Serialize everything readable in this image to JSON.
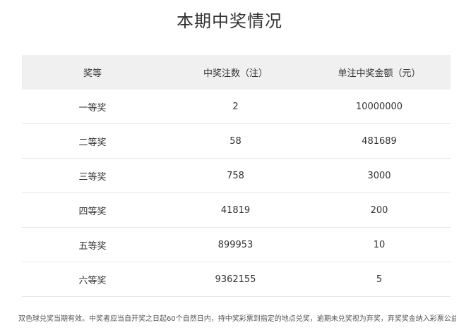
{
  "title": "本期中奖情况",
  "table": {
    "headers": [
      "奖等",
      "中奖注数（注）",
      "单注中奖金额（元）"
    ],
    "rows": [
      {
        "level": "一等奖",
        "count": "2",
        "amount": "10000000"
      },
      {
        "level": "二等奖",
        "count": "58",
        "amount": "481689"
      },
      {
        "level": "三等奖",
        "count": "758",
        "amount": "3000"
      },
      {
        "level": "四等奖",
        "count": "41819",
        "amount": "200"
      },
      {
        "level": "五等奖",
        "count": "899953",
        "amount": "10"
      },
      {
        "level": "六等奖",
        "count": "9362155",
        "amount": "5"
      }
    ]
  },
  "footnote": "双色球兑奖当期有效。中奖者应当自开奖之日起60个自然日内，持中奖彩票到指定的地点兑奖，逾期未兑奖视为弃奖，弃奖奖金纳入彩票公益金。"
}
